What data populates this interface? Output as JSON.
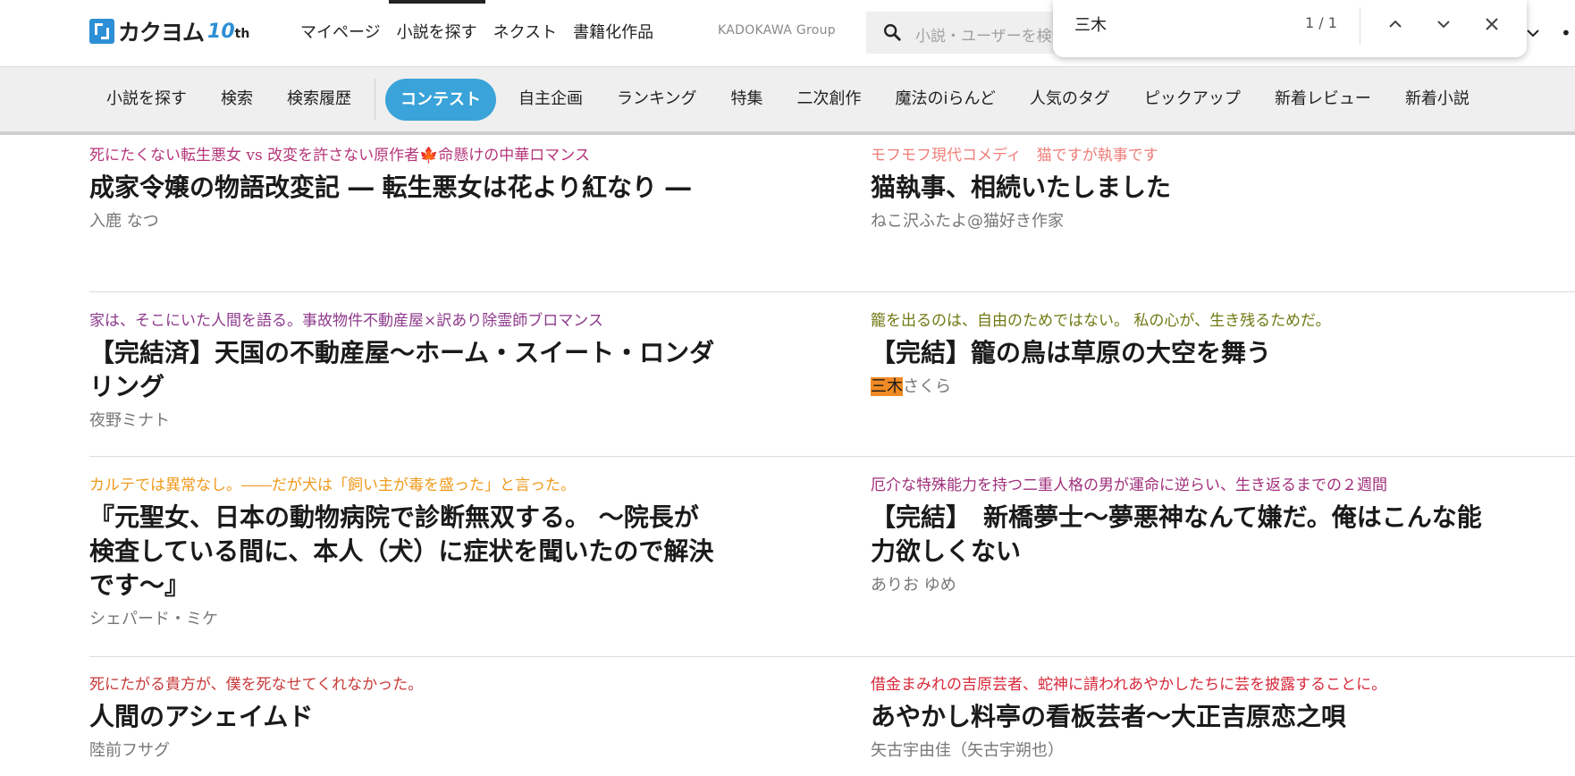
{
  "header": {
    "logo_text": "カクヨム",
    "logo_badge": "10",
    "logo_badge_suffix": "th",
    "nav": [
      "マイページ",
      "小説を探す",
      "ネクスト",
      "書籍化作品"
    ],
    "active_nav": "小説を探す",
    "group_label": "KADOKAWA Group",
    "search_placeholder": "小説・ユーザーを検索"
  },
  "subnav": {
    "items_before": [
      "小説を探す",
      "検索",
      "検索履歴"
    ],
    "contest_label": "コンテスト",
    "items_after": [
      "自主企画",
      "ランキング",
      "特集",
      "二次創作",
      "魔法のiらんど",
      "人気のタグ",
      "ピックアップ",
      "新着レビュー",
      "新着小説"
    ]
  },
  "find_bar": {
    "query": "三木",
    "match_count": "1 / 1"
  },
  "works": [
    {
      "catch": "死にたくない転生悪女 vs 改変を許さない原作者🍁命懸けの中華ロマンス",
      "catch_color": "#b5367a",
      "title": "成家令嬢の物語改変記 ― 転生悪女は花より紅なり ―",
      "author": "入鹿 なつ"
    },
    {
      "catch": "モフモフ現代コメディ　猫ですが執事です",
      "catch_color": "#ef7f7a",
      "title": "猫執事、相続いたしました",
      "author": "ねこ沢ふたよ@猫好き作家"
    },
    {
      "catch": "家は、そこにいた人間を語る。事故物件不動産屋×訳あり除霊師ブロマンス",
      "catch_color": "#8e3a8c",
      "title": "【完結済】天国の不動産屋～ホーム・スイート・ロンダリング",
      "author": "夜野ミナト"
    },
    {
      "catch": "籠を出るのは、自由のためではない。 私の心が、生き残るためだ。",
      "catch_color": "#6f7a14",
      "title": "【完結】籠の鳥は草原の大空を舞う",
      "author_highlight": "三木",
      "author_rest": "さくら"
    },
    {
      "catch": "カルテでは異常なし。――だが犬は「飼い主が毒を盛った」と言った。",
      "catch_color": "#ef9a1c",
      "title": "『元聖女、日本の動物病院で診断無双する。 ～院長が検査している間に、本人（犬）に症状を聞いたので解決です～』",
      "author": "シェパード・ミケ"
    },
    {
      "catch": "厄介な特殊能力を持つ二重人格の男が運命に逆らい、生き返るまでの２週間",
      "catch_color": "#a1307c",
      "title": "【完結】　新橋夢士～夢悪神なんて嫌だ。俺はこんな能力欲しくない",
      "author": "ありお ゆめ"
    },
    {
      "catch": "死にたがる貴方が、僕を死なせてくれなかった。",
      "catch_color": "#c83a3a",
      "title": "人間のアシェイムド",
      "author": "陸前フサグ"
    },
    {
      "catch": "借金まみれの吉原芸者、蛇神に請われあやかしたちに芸を披露することに。",
      "catch_color": "#d8283a",
      "title": "あやかし料亭の看板芸者～大正吉原恋之唄",
      "author": "矢古宇由佳（矢古宇朔也）"
    }
  ]
}
